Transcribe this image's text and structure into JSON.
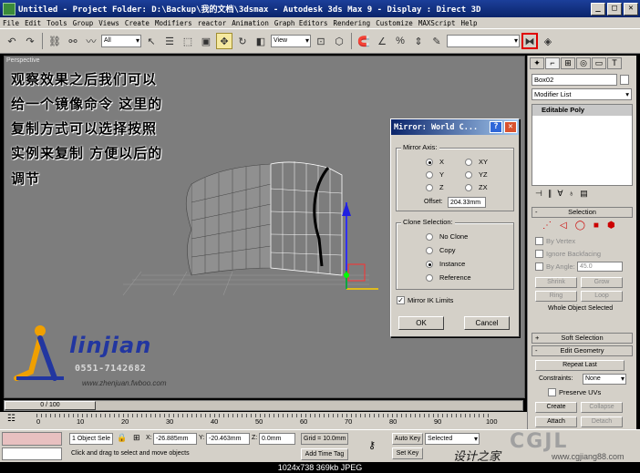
{
  "window": {
    "title": "Untitled    - Project Folder: D:\\Backup\\我的文档\\3dsmax    - Autodesk 3ds Max 9    - Display : Direct 3D",
    "min": "_",
    "max": "□",
    "close": "✕"
  },
  "menu": [
    "File",
    "Edit",
    "Tools",
    "Group",
    "Views",
    "Create",
    "Modifiers",
    "reactor",
    "Animation",
    "Graph Editors",
    "Rendering",
    "Customize",
    "MAXScript",
    "Help"
  ],
  "toolbar": {
    "selection_filter": "All",
    "ref_coord": "View"
  },
  "viewport": {
    "label": "Perspective",
    "overlay_lines": [
      "观察效果之后我们可以",
      "给一个镜像命令 这里的",
      "复制方式可以选择按照",
      "实例来复制 方便以后的",
      "调节"
    ],
    "logo_brand": "linjian",
    "logo_phone": "0551-7142682",
    "logo_site": "www.zhenjuan.fwboo.com"
  },
  "mirror_dialog": {
    "title": "Mirror: World C...",
    "help": "?",
    "close": "✕",
    "axis_group": "Mirror Axis:",
    "axes": [
      {
        "label": "X",
        "selected": true
      },
      {
        "label": "Y",
        "selected": false
      },
      {
        "label": "Z",
        "selected": false
      },
      {
        "label": "XY",
        "selected": false
      },
      {
        "label": "YZ",
        "selected": false
      },
      {
        "label": "ZX",
        "selected": false
      }
    ],
    "offset_label": "Offset:",
    "offset_value": "204.33mm",
    "clone_group": "Clone Selection:",
    "clone_options": [
      {
        "label": "No Clone",
        "selected": false
      },
      {
        "label": "Copy",
        "selected": false
      },
      {
        "label": "Instance",
        "selected": true
      },
      {
        "label": "Reference",
        "selected": false
      }
    ],
    "ik_label": "Mirror IK Limits",
    "ik_checked": true,
    "ok": "OK",
    "cancel": "Cancel"
  },
  "command_panel": {
    "object_name": "Box02",
    "modifier_list": "Modifier List",
    "stack_item": "Editable Poly",
    "selection_rollout": "Selection",
    "by_vertex": "By Vertex",
    "ignore_backfacing": "Ignore Backfacing",
    "by_angle": "By Angle:",
    "angle_value": "45.0",
    "shrink": "Shrink",
    "grow": "Grow",
    "ring": "Ring",
    "loop": "Loop",
    "whole_object": "Whole Object Selected",
    "soft_selection": "Soft Selection",
    "edit_geometry": "Edit Geometry",
    "repeat_last": "Repeat Last",
    "constraints_label": "Constraints:",
    "constraints_value": "None",
    "preserve_uvs": "Preserve UVs",
    "create": "Create",
    "collapse": "Collapse",
    "attach": "Attach",
    "detach": "Detach"
  },
  "timeline": {
    "slider": "0 / 100",
    "ticks": [
      "0",
      "10",
      "20",
      "30",
      "40",
      "50",
      "60",
      "70",
      "80",
      "90",
      "100"
    ]
  },
  "status": {
    "selected": "1 Object Sele",
    "prompt": "Click and drag to select and move objects",
    "x_label": "X:",
    "x_value": "-26.885mm",
    "y_label": "Y:",
    "y_value": "-20.463mm",
    "z_label": "Z:",
    "z_value": "0.0mm",
    "grid": "Grid = 10.0mm",
    "add_time_tag": "Add Time Tag",
    "auto_key": "Auto Key",
    "set_key": "Set Key",
    "key_mode": "Selected"
  },
  "watermark": {
    "cn": "设计之家",
    "brand": "CGJL",
    "url": "www.cgjiang88.com"
  },
  "image_info": "1024x738  369kb  JPEG"
}
